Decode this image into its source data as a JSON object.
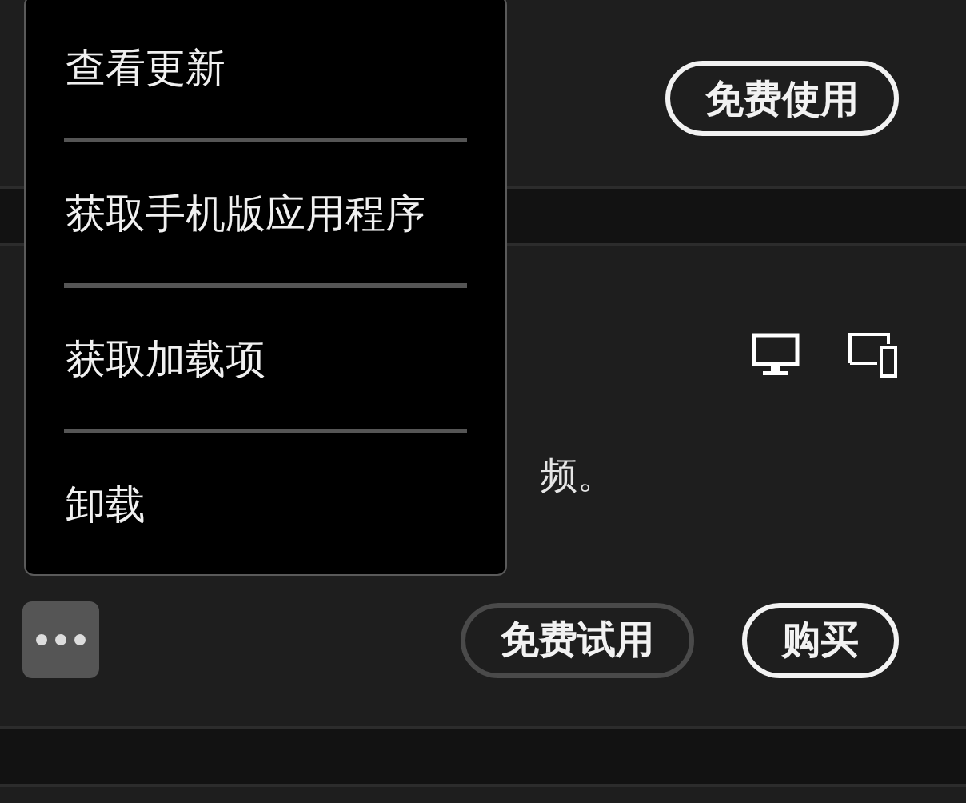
{
  "menu": {
    "items": [
      {
        "label": "查看更新"
      },
      {
        "label": "获取手机版应用程序"
      },
      {
        "label": "获取加载项"
      },
      {
        "label": "卸载"
      }
    ]
  },
  "cards": [
    {
      "buttons": [
        {
          "label": "免费使用",
          "kind": "primary"
        }
      ]
    },
    {
      "description": "频。",
      "buttons": [
        {
          "label": "免费试用",
          "kind": "secondary"
        },
        {
          "label": "购买",
          "kind": "primary"
        }
      ]
    }
  ]
}
